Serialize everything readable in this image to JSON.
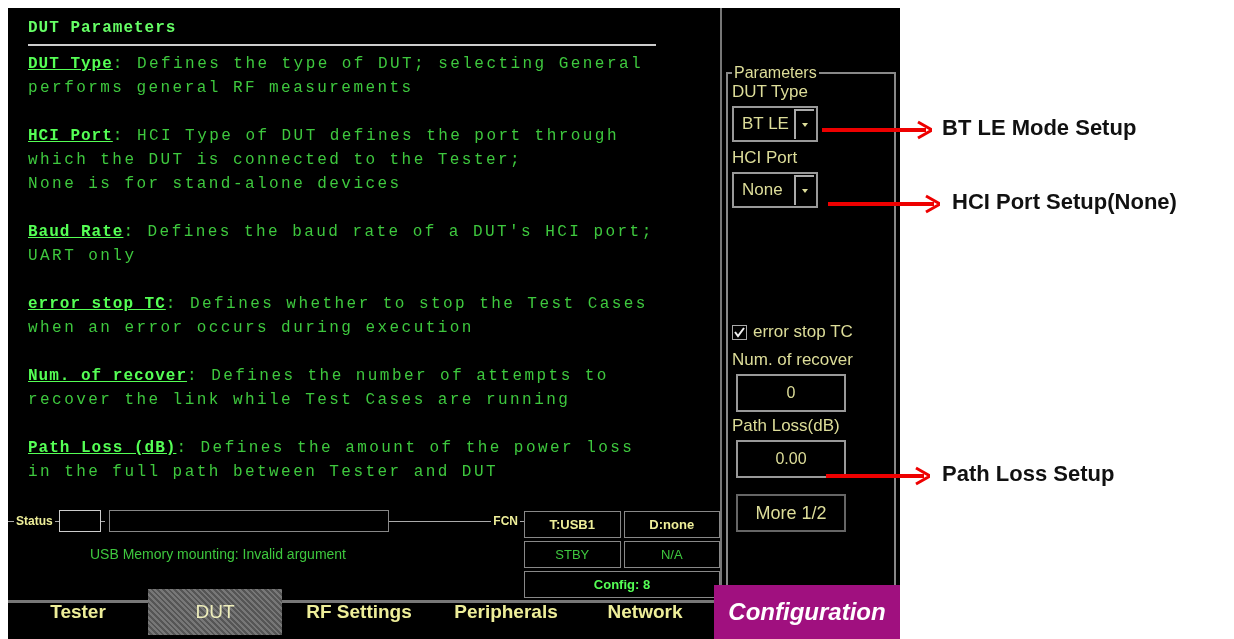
{
  "help": {
    "title": "DUT Parameters",
    "entries": [
      {
        "term": "DUT Type",
        "text": ": Defines the type of DUT; selecting General\nperforms general RF measurements"
      },
      {
        "term": "HCI Port",
        "text": ": HCI Type of DUT defines the port through\nwhich the DUT is connected to the Tester;\nNone is for stand-alone devices"
      },
      {
        "term": "Baud Rate",
        "text": ": Defines the baud rate of a DUT's HCI port;\nUART only"
      },
      {
        "term": "error stop TC",
        "text": ": Defines whether to stop the Test Cases\nwhen an error occurs during execution"
      },
      {
        "term": "Num. of recover",
        "text": ": Defines the number of attempts to\nrecover the link while Test Cases are running"
      },
      {
        "term": "Path Loss (dB)",
        "text": ": Defines the amount of the power loss\nin the full path between Tester and DUT"
      }
    ]
  },
  "status": {
    "label": "Status",
    "fcn_label": "FCN",
    "message": "USB Memory mounting: Invalid argument",
    "cells": [
      "T:USB1",
      "D:none",
      "STBY",
      "N/A",
      "Config: 8"
    ]
  },
  "parameters": {
    "title": "Parameters",
    "dut_type": {
      "label": "DUT Type",
      "value": "BT LE"
    },
    "hci_port": {
      "label": "HCI Port",
      "value": "None"
    },
    "error_stop": {
      "label": "error stop TC",
      "checked": true
    },
    "num_recover": {
      "label": "Num. of recover",
      "value": "0"
    },
    "path_loss": {
      "label": "Path Loss(dB)",
      "value": "0.00"
    },
    "more": "More 1/2"
  },
  "tabs": [
    {
      "label": "Tester",
      "selected": false
    },
    {
      "label": "DUT",
      "selected": true
    },
    {
      "label": "RF Settings",
      "selected": false
    },
    {
      "label": "Peripherals",
      "selected": false
    },
    {
      "label": "Network",
      "selected": false
    }
  ],
  "mode": "Configuration",
  "annotations": [
    {
      "text": "BT LE Mode Setup"
    },
    {
      "text": "HCI Port Setup(None)"
    },
    {
      "text": "Path Loss Setup"
    }
  ]
}
